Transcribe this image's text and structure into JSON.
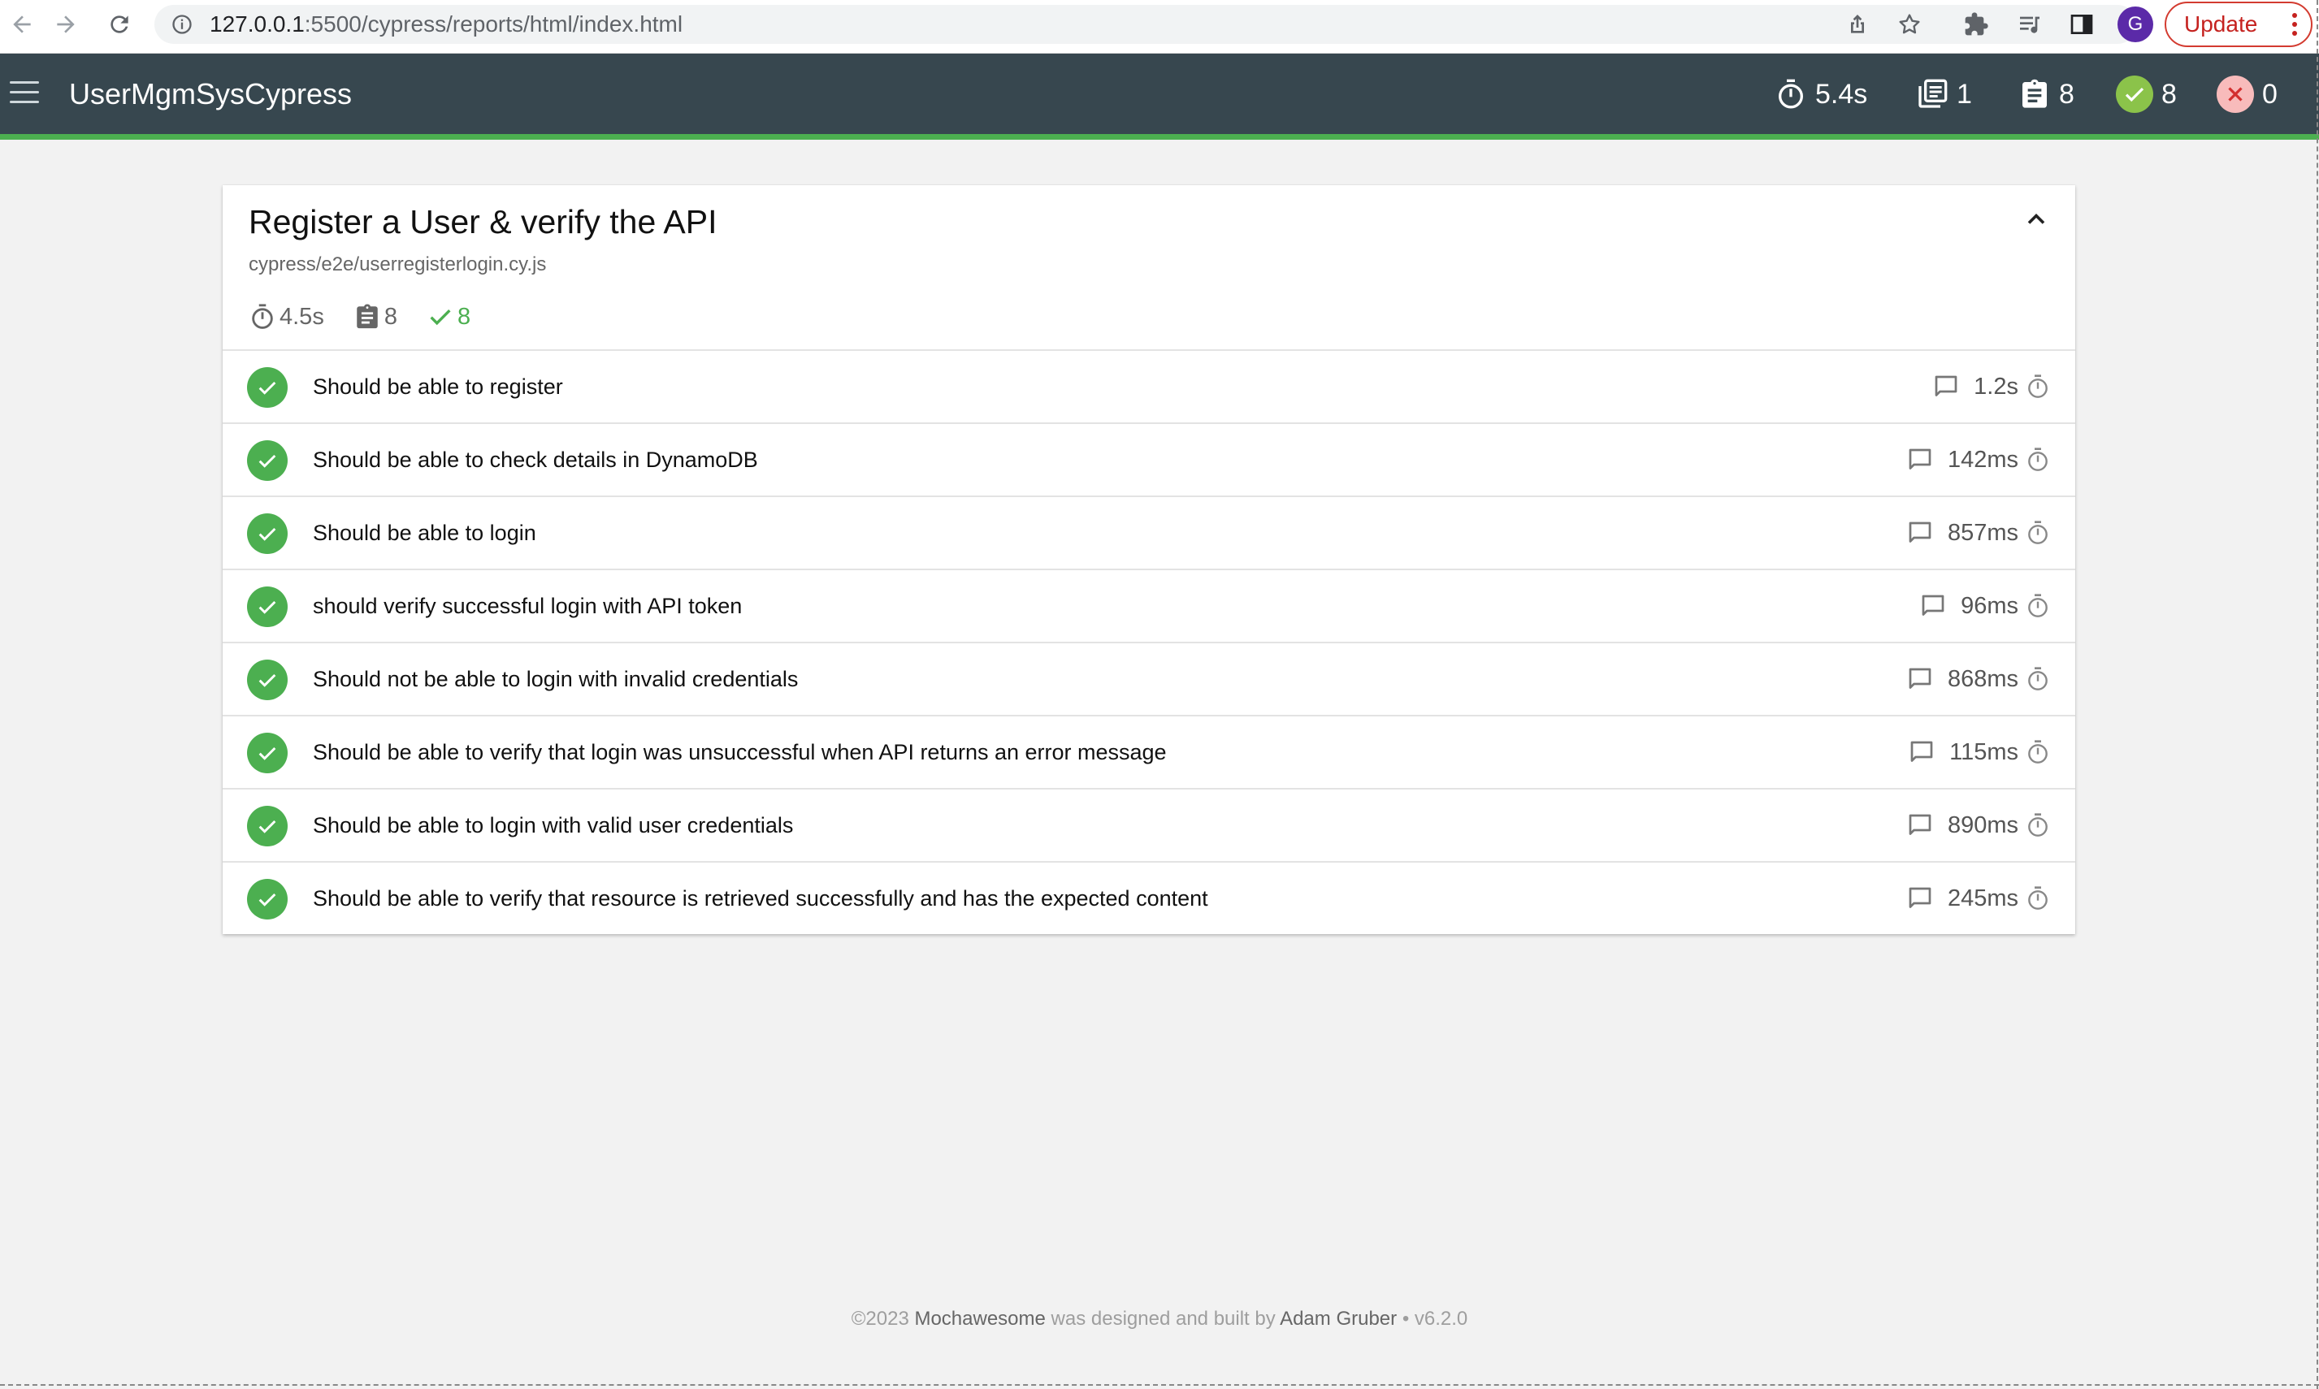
{
  "browser": {
    "url_host": "127.0.0.1",
    "url_path": ":5500/cypress/reports/html/index.html",
    "profile_initial": "G",
    "update_label": "Update"
  },
  "navbar": {
    "title": "UserMgmSysCypress",
    "stats": {
      "duration": "5.4s",
      "suites": "1",
      "tests": "8",
      "passed": "8",
      "failed": "0"
    }
  },
  "suite": {
    "title": "Register a User & verify the API",
    "file": "cypress/e2e/userregisterlogin.cy.js",
    "duration": "4.5s",
    "tests": "8",
    "passed": "8",
    "tests_list": [
      {
        "title": "Should be able to register",
        "duration": "1.2s"
      },
      {
        "title": "Should be able to check details in DynamoDB",
        "duration": "142ms"
      },
      {
        "title": "Should be able to login",
        "duration": "857ms"
      },
      {
        "title": "should verify successful login with API token",
        "duration": "96ms"
      },
      {
        "title": "Should not be able to login with invalid credentials",
        "duration": "868ms"
      },
      {
        "title": "Should be able to verify that login was unsuccessful when API returns an error message",
        "duration": "115ms"
      },
      {
        "title": "Should be able to login with valid user credentials",
        "duration": "890ms"
      },
      {
        "title": "Should be able to verify that resource is retrieved successfully and has the expected content",
        "duration": "245ms"
      }
    ]
  },
  "footer": {
    "copyright": "©2023",
    "brand": "Mochawesome",
    "middle": "was designed and built by",
    "author": "Adam Gruber",
    "version": "• v6.2.0"
  },
  "colors": {
    "navbar": "#37474f",
    "pass": "#4caf50",
    "fail": "#f8bbbb"
  }
}
